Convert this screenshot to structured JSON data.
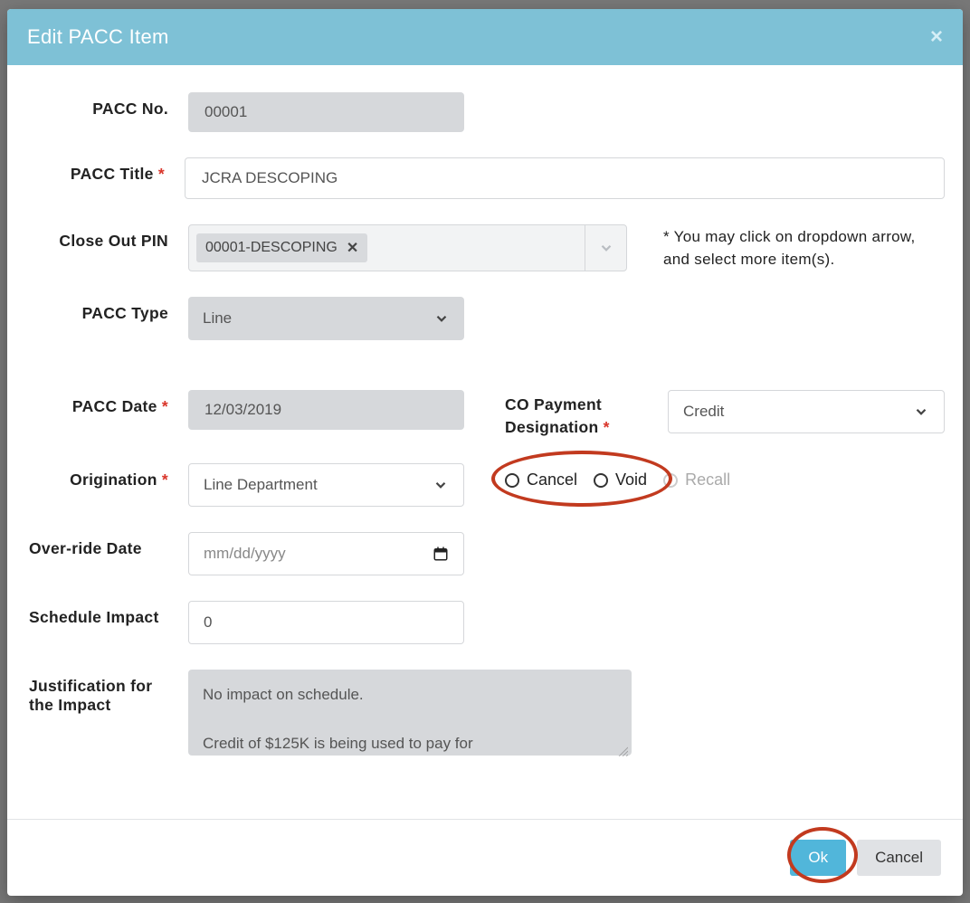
{
  "modal": {
    "title": "Edit PACC Item"
  },
  "form": {
    "pacc_no": {
      "label": "PACC No.",
      "value": "00001"
    },
    "pacc_title": {
      "label": "PACC Title",
      "value": "JCRA DESCOPING"
    },
    "close_out_pin": {
      "label": "Close Out PIN",
      "chip": "00001-DESCOPING",
      "helper": "* You may click on dropdown arrow, and select more item(s)."
    },
    "pacc_type": {
      "label": "PACC Type",
      "value": "Line"
    },
    "pacc_date": {
      "label": "PACC Date",
      "value": "12/03/2019"
    },
    "co_payment": {
      "label": "CO Payment Designation",
      "value": "Credit"
    },
    "origination": {
      "label": "Origination",
      "value": "Line Department"
    },
    "radios": {
      "cancel": "Cancel",
      "void": "Void",
      "recall": "Recall"
    },
    "override_date": {
      "label": "Over-ride Date",
      "placeholder": "mm/dd/yyyy"
    },
    "schedule_impact": {
      "label": "Schedule Impact",
      "value": "0"
    },
    "justification": {
      "label": "Justification for the Impact",
      "value": "No impact on schedule.\n\nCredit of $125K is being used to pay for"
    }
  },
  "footer": {
    "ok": "Ok",
    "cancel": "Cancel"
  }
}
